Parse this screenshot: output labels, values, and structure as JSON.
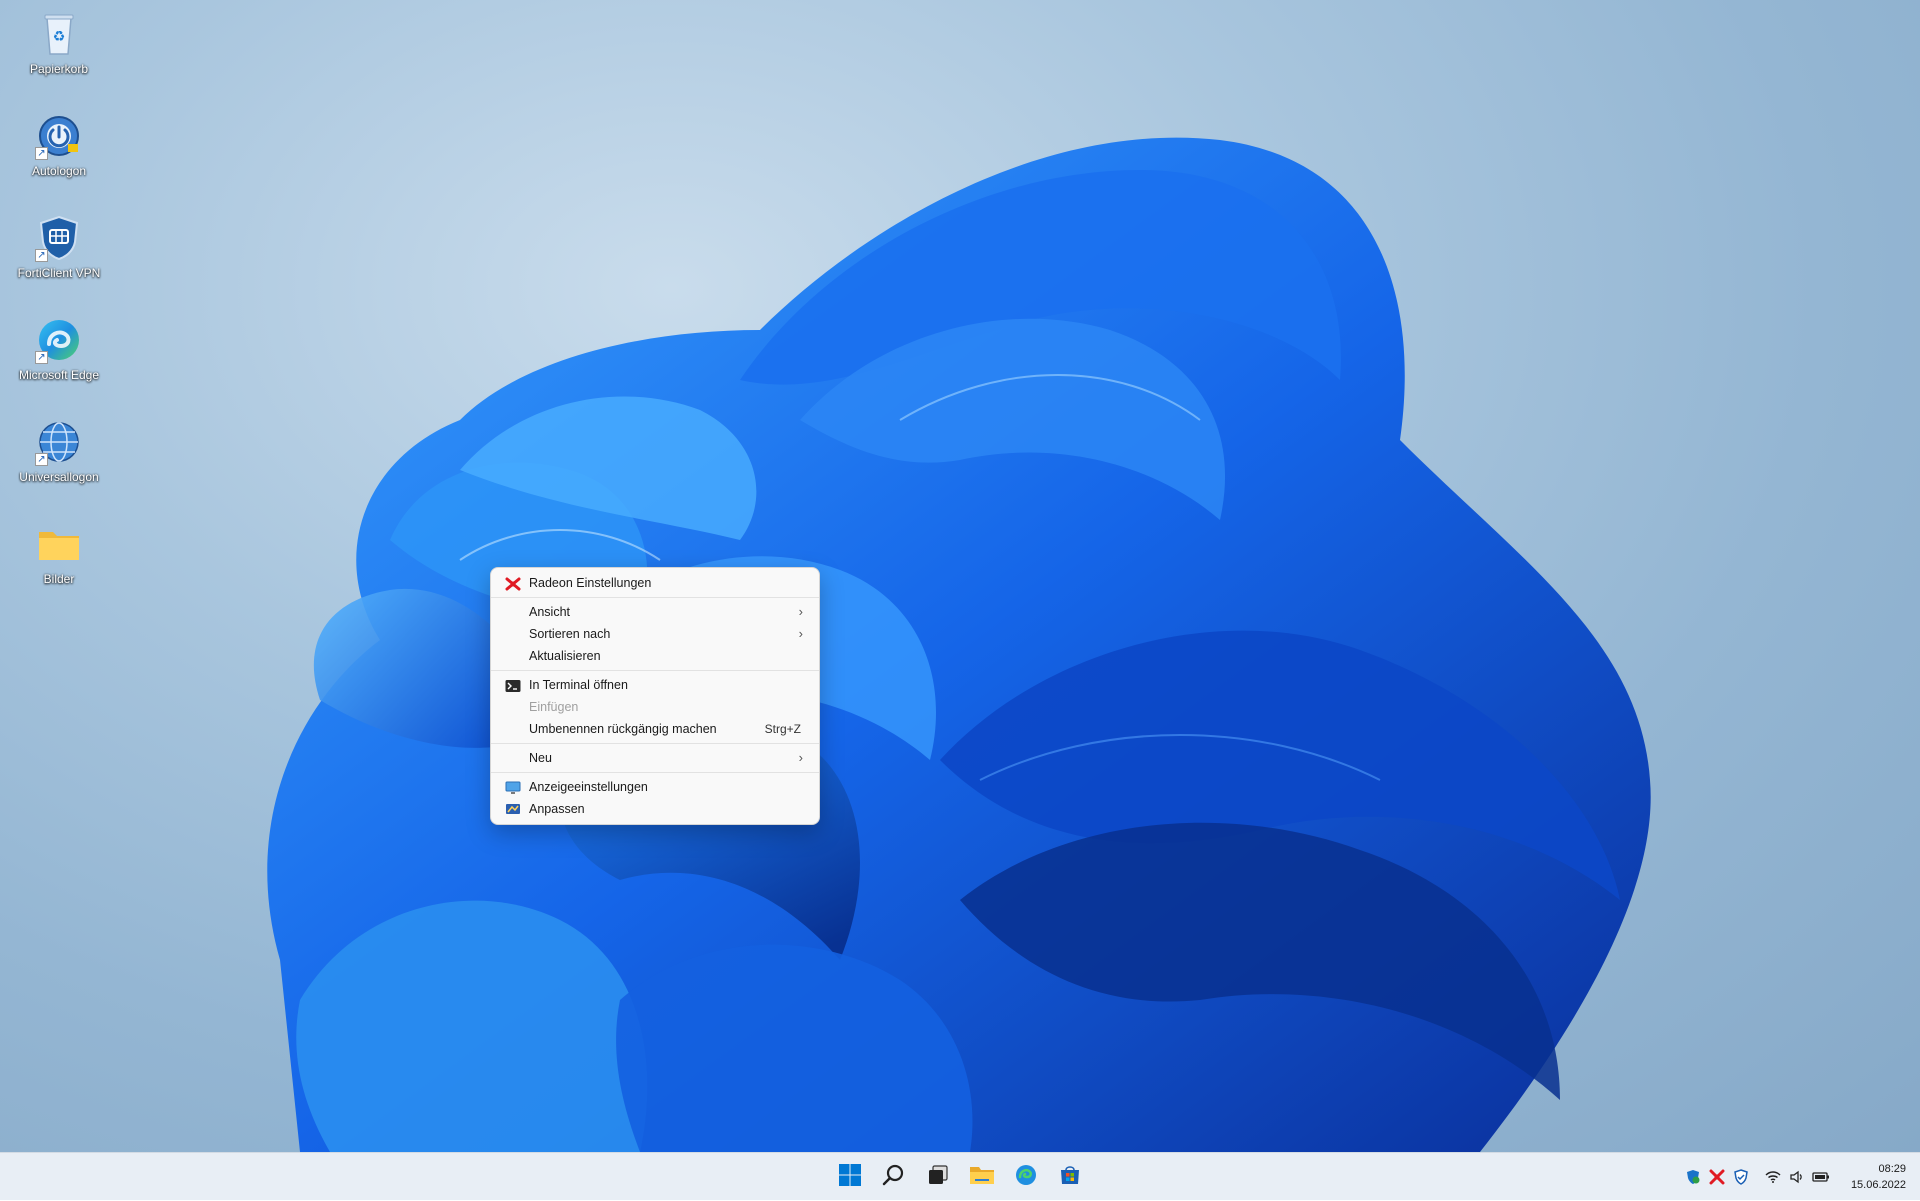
{
  "desktop": {
    "icons": [
      {
        "label": "Papierkorb",
        "icon": "recycle-bin-icon"
      },
      {
        "label": "Autologon",
        "icon": "autologon-icon",
        "shortcut": true
      },
      {
        "label": "FortiClient VPN",
        "icon": "forticlient-shield-icon",
        "shortcut": true
      },
      {
        "label": "Microsoft Edge",
        "icon": "edge-icon",
        "shortcut": true
      },
      {
        "label": "Universallogon",
        "icon": "globe-icon",
        "shortcut": true
      },
      {
        "label": "Bilder",
        "icon": "folder-icon"
      }
    ]
  },
  "context_menu": {
    "items": [
      {
        "label": "Radeon Einstellungen",
        "icon": "radeon-icon"
      },
      {
        "label": "Ansicht",
        "submenu": true
      },
      {
        "label": "Sortieren nach",
        "submenu": true
      },
      {
        "label": "Aktualisieren"
      },
      {
        "label": "In Terminal öffnen",
        "icon": "terminal-icon"
      },
      {
        "label": "Einfügen",
        "disabled": true
      },
      {
        "label": "Umbenennen rückgängig machen",
        "shortcut": "Strg+Z"
      },
      {
        "label": "Neu",
        "submenu": true
      },
      {
        "label": "Anzeigeeinstellungen",
        "icon": "display-settings-icon"
      },
      {
        "label": "Anpassen",
        "icon": "personalize-icon"
      }
    ]
  },
  "taskbar": {
    "apps": [
      "start-icon",
      "search-icon",
      "task-view-icon",
      "file-explorer-icon",
      "edge-icon",
      "store-icon"
    ],
    "tray": [
      "defender-icon",
      "radeon-icon",
      "security-shield-icon",
      "wifi-icon",
      "volume-icon",
      "battery-icon"
    ],
    "clock": {
      "time": "08:29",
      "date": "15.06.2022"
    }
  },
  "colors": {
    "accent": "#0078d4",
    "bloom_dark": "#0a3fb8",
    "bloom_light": "#2a8ef0"
  }
}
